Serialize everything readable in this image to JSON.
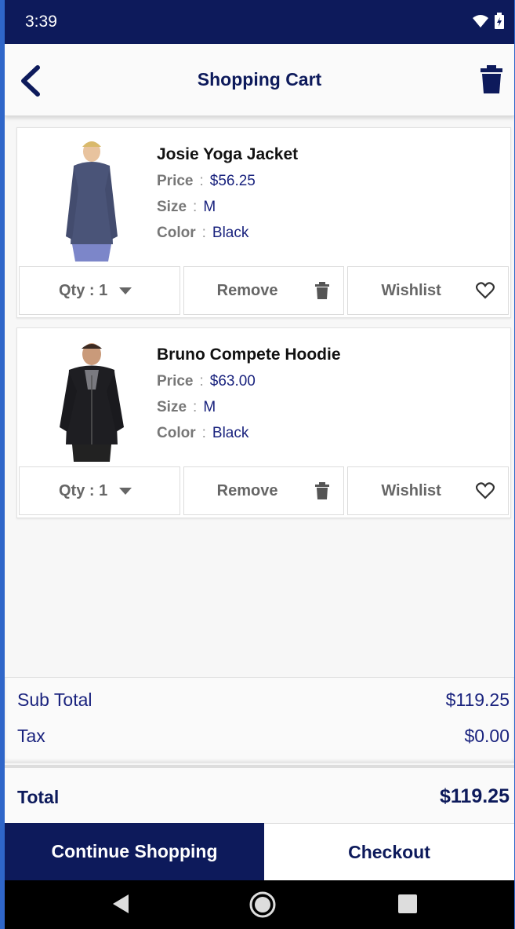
{
  "status": {
    "time": "3:39"
  },
  "header": {
    "title": "Shopping Cart"
  },
  "items": [
    {
      "name": "Josie Yoga Jacket",
      "price_label": "Price",
      "price": "$56.25",
      "size_label": "Size",
      "size": "M",
      "color_label": "Color",
      "color": "Black",
      "qty": "Qty : 1",
      "remove_label": "Remove",
      "wishlist_label": "Wishlist"
    },
    {
      "name": "Bruno Compete Hoodie",
      "price_label": "Price",
      "price": "$63.00",
      "size_label": "Size",
      "size": "M",
      "color_label": "Color",
      "color": "Black",
      "qty": "Qty : 1",
      "remove_label": "Remove",
      "wishlist_label": "Wishlist"
    }
  ],
  "summary": {
    "subtotal_label": "Sub Total",
    "subtotal": "$119.25",
    "tax_label": "Tax",
    "tax": "$0.00",
    "total_label": "Total",
    "total": "$119.25"
  },
  "buttons": {
    "continue": "Continue Shopping",
    "checkout": "Checkout"
  },
  "colors": {
    "primary": "#0d1a5b",
    "accent": "#1a237e"
  }
}
